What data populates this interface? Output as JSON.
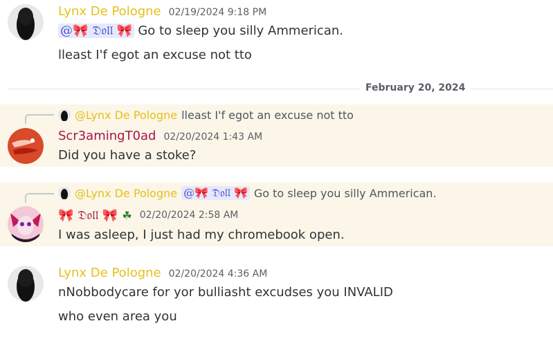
{
  "messages": [
    {
      "author": "Lynx De Pologne",
      "timestamp": "02/19/2024 9:18 PM",
      "mention": "@🎀 𝔇𝔬𝔩𝔩 🎀",
      "lines": [
        "Go to sleep you silly Ammerican.",
        "lleast I'f egot an excuse not tto"
      ]
    },
    {
      "reply": {
        "author": "@Lynx De Pologne",
        "text": "lleast I'f egot an excuse not tto"
      },
      "author": "Scr3amingT0ad",
      "timestamp": "02/20/2024 1:43 AM",
      "lines": [
        "Did you have a stoke?"
      ]
    },
    {
      "reply": {
        "author": "@Lynx De Pologne",
        "mention": "@🎀 𝔇𝔬𝔩𝔩 🎀",
        "text": "Go to sleep you silly Ammerican."
      },
      "author": "🎀 𝔇𝔬𝔩𝔩 🎀",
      "author_badge": "☘",
      "timestamp": "02/20/2024 2:58 AM",
      "lines": [
        "I was asleep, I just had my chromebook open."
      ]
    },
    {
      "author": "Lynx De Pologne",
      "timestamp": "02/20/2024 4:36 AM",
      "lines": [
        "nNobbodycare for yor bulliasht excudses you INVALID",
        "who even area you"
      ]
    }
  ],
  "date_divider": "February 20, 2024",
  "colors": {
    "lynx": "#e6c01b",
    "toad": "#a5154a",
    "highlight": "#fbf6e7",
    "mention_bg": "#e6e8fd"
  }
}
